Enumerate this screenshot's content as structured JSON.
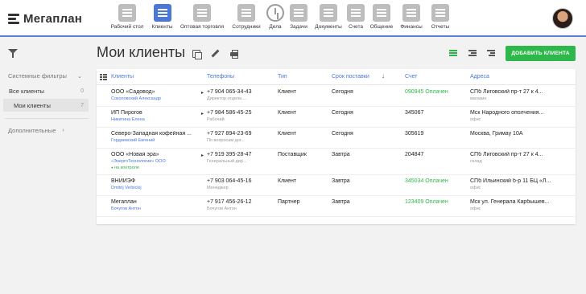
{
  "app": {
    "logo_text": "Мегаплан"
  },
  "nav": [
    {
      "label": "Рабочий стол",
      "icon": "dashboard-icon",
      "active": false
    },
    {
      "label": "Клиенты",
      "icon": "clients-icon",
      "active": true
    },
    {
      "label": "Оптовая торговля",
      "icon": "briefcase-icon",
      "active": false
    },
    {
      "label": "Сотрудники",
      "icon": "employees-icon",
      "active": false
    },
    {
      "label": "Дела",
      "icon": "clock-icon",
      "active": false
    },
    {
      "label": "Задачи",
      "icon": "tasks-icon",
      "active": false
    },
    {
      "label": "Документы",
      "icon": "folder-icon",
      "active": false
    },
    {
      "label": "Счета",
      "icon": "invoice-icon",
      "active": false
    },
    {
      "label": "Общение",
      "icon": "chat-icon",
      "active": false
    },
    {
      "label": "Финансы",
      "icon": "safe-icon",
      "active": false
    },
    {
      "label": "Отчеты",
      "icon": "reports-icon",
      "active": false
    }
  ],
  "sidebar": {
    "system_filters": "Системные фильтры",
    "items": [
      {
        "label": "Все клиенты",
        "count": "0"
      },
      {
        "label": "Мои клиенты",
        "count": "7"
      }
    ],
    "extra": "Дополнительные"
  },
  "page": {
    "title": "Мои клиенты",
    "add_button": "ДОБАВИТЬ КЛИЕНТА"
  },
  "table": {
    "headers": {
      "client": "Клиенты",
      "phones": "Телефоны",
      "type": "Тип",
      "delivery": "Срок поставки",
      "invoice": "Счет",
      "address": "Адреса"
    },
    "rows": [
      {
        "name": "ООО «Садовод»",
        "contact": "Соколовский Александр",
        "note": "",
        "phone": "+7 904 065-34-43",
        "phone_sub": "Директор отдела ...",
        "type": "Клиент",
        "delivery": "Сегодня",
        "invoice": "090945 Оплачен",
        "invoice_paid": true,
        "address": "СПб Лиговский пр-т 27 к 4...",
        "address_sub": "магазин",
        "expand": true
      },
      {
        "name": "ИП Пирогов",
        "contact": "Никитина Елена",
        "note": "",
        "phone": "+7 984 586-45-25",
        "phone_sub": "Рабочий",
        "type": "Клиент",
        "delivery": "Сегодня",
        "invoice": "345067",
        "invoice_paid": false,
        "address": "Мск Народного ополчения...",
        "address_sub": "офис",
        "expand": true
      },
      {
        "name": "Северо-Западная кофейная ...",
        "contact": "Гордиевский Евгений",
        "note": "",
        "phone": "+7 927 894-23-69",
        "phone_sub": "По вопросам дог...",
        "type": "Клиент",
        "delivery": "Сегодня",
        "invoice": "305619",
        "invoice_paid": false,
        "address": "Москва, Гримау 10А",
        "address_sub": "",
        "expand": false
      },
      {
        "name": "ООО «Новая эра»",
        "contact": "«ЭнергоТехнологии» ООО",
        "note": "на контроле",
        "phone": "+7 919 395-28-47",
        "phone_sub": "Генеральный дир...",
        "type": "Поставщик",
        "delivery": "Завтра",
        "invoice": "204847",
        "invoice_paid": false,
        "address": "СПб Лиговский пр-т 27 к 4...",
        "address_sub": "склад",
        "expand": true
      },
      {
        "name": "ВНИИЭФ",
        "contact": "Dmitrij Verbickij",
        "note": "",
        "phone": "+7 903 064-45-16",
        "phone_sub": "Менеджер",
        "type": "Клиент",
        "delivery": "Завтра",
        "invoice": "345034 Оплачен",
        "invoice_paid": true,
        "address": "СПб Ильинский б-р 11 БЦ «Л...",
        "address_sub": "офис",
        "expand": false
      },
      {
        "name": "Мегаплан",
        "contact": "Бочугов Антон",
        "note": "",
        "phone": "+7 917 456-26-12",
        "phone_sub": "Бочугов Антон",
        "type": "Партнер",
        "delivery": "Завтра",
        "invoice": "123409 Оплачен",
        "invoice_paid": true,
        "address": "Мск ул. Генерала Карбышев...",
        "address_sub": "офис",
        "expand": false
      }
    ]
  },
  "colors": {
    "accent": "#4a78d8",
    "success": "#2eb84b"
  }
}
